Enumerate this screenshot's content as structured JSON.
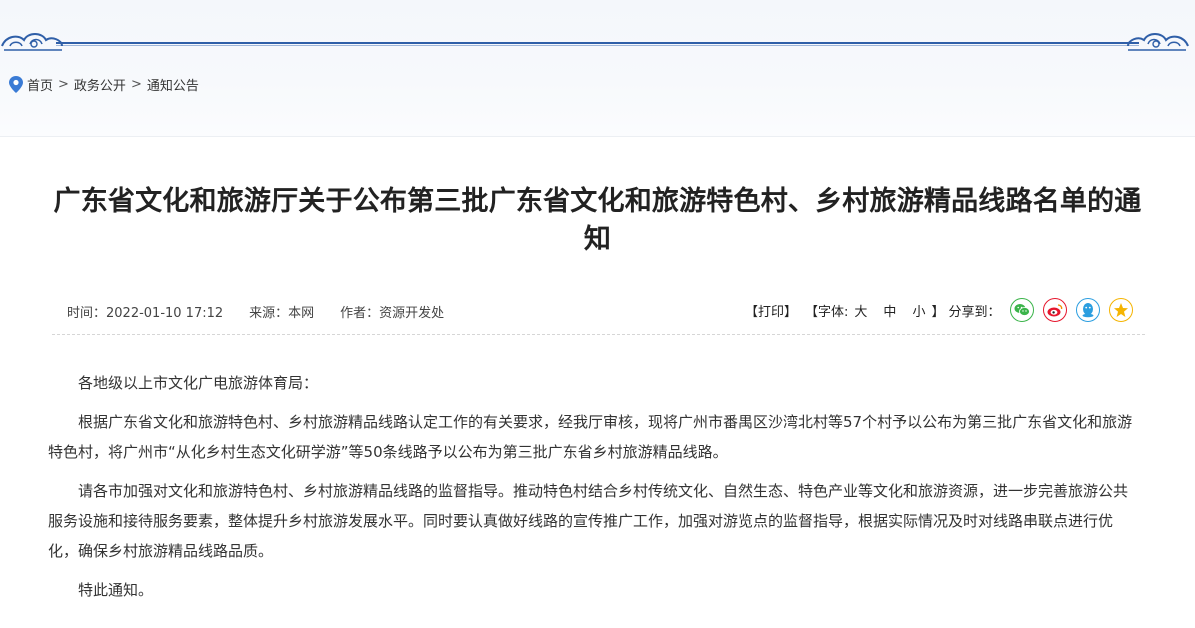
{
  "breadcrumb": {
    "items": [
      "首页",
      "政务公开",
      "通知公告"
    ],
    "separator": ">"
  },
  "article": {
    "title": "广东省文化和旅游厅关于公布第三批广东省文化和旅游特色村、乡村旅游精品线路名单的通知",
    "meta": {
      "time": "时间：2022-01-10 17:12",
      "source": "来源：本网",
      "author": "作者：资源开发处"
    },
    "paragraphs": [
      "各地级以上市文化广电旅游体育局：",
      "根据广东省文化和旅游特色村、乡村旅游精品线路认定工作的有关要求，经我厅审核，现将广州市番禺区沙湾北村等57个村予以公布为第三批广东省文化和旅游特色村，将广州市“从化乡村生态文化研学游”等50条线路予以公布为第三批广东省乡村旅游精品线路。",
      "请各市加强对文化和旅游特色村、乡村旅游精品线路的监督指导。推动特色村结合乡村传统文化、自然生态、特色产业等文化和旅游资源，进一步完善旅游公共服务设施和接待服务要素，整体提升乡村旅游发展水平。同时要认真做好线路的宣传推广工作，加强对游览点的监督指导，根据实际情况及时对线路串联点进行优化，确保乡村旅游精品线路品质。",
      "特此通知。"
    ]
  },
  "tools": {
    "print": "【打印】",
    "font_prefix": "【字体:",
    "font_large": "大",
    "font_medium": "中",
    "font_small": "小",
    "font_suffix": "】",
    "share_label": "分享到："
  },
  "share_icons": [
    {
      "name": "wechat-icon",
      "color": "#3bb44a"
    },
    {
      "name": "weibo-icon",
      "color": "#e6162d"
    },
    {
      "name": "qq-icon",
      "color": "#2b9ee0"
    },
    {
      "name": "qzone-icon",
      "color": "#f5b400"
    }
  ],
  "colors": {
    "accent_blue": "#2f5fa8",
    "title": "#222222",
    "text": "#333333"
  }
}
